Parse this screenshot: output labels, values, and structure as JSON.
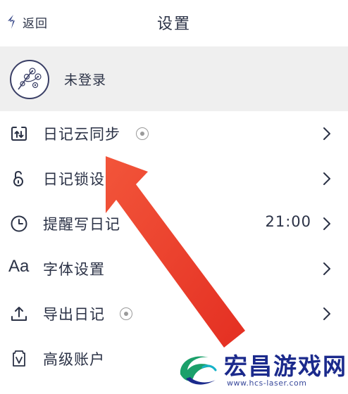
{
  "header": {
    "back_label": "返回",
    "title": "设置"
  },
  "user": {
    "name": "未登录"
  },
  "settings": [
    {
      "label": "日记云同步",
      "value": "",
      "icon": "cloud-sync-icon",
      "badge": true
    },
    {
      "label": "日记锁设置",
      "value": "",
      "icon": "lock-icon",
      "badge": false
    },
    {
      "label": "提醒写日记",
      "value": "21:00",
      "icon": "clock-icon",
      "badge": false
    },
    {
      "label": "字体设置",
      "value": "",
      "icon": "font-aa-icon",
      "icon_text": "Aa",
      "badge": false
    },
    {
      "label": "导出日记",
      "value": "",
      "icon": "export-icon",
      "badge": true
    },
    {
      "label": "高级账户",
      "value": "",
      "icon": "premium-account-icon",
      "badge": false
    }
  ],
  "watermark": {
    "name": "宏昌游戏网",
    "url": "www.hcs-laser.com"
  },
  "colors": {
    "text": "#2b3246",
    "user_band": "#efefef",
    "annotation_arrow": "#ee3b2a",
    "watermark": "#1b2a8c"
  }
}
